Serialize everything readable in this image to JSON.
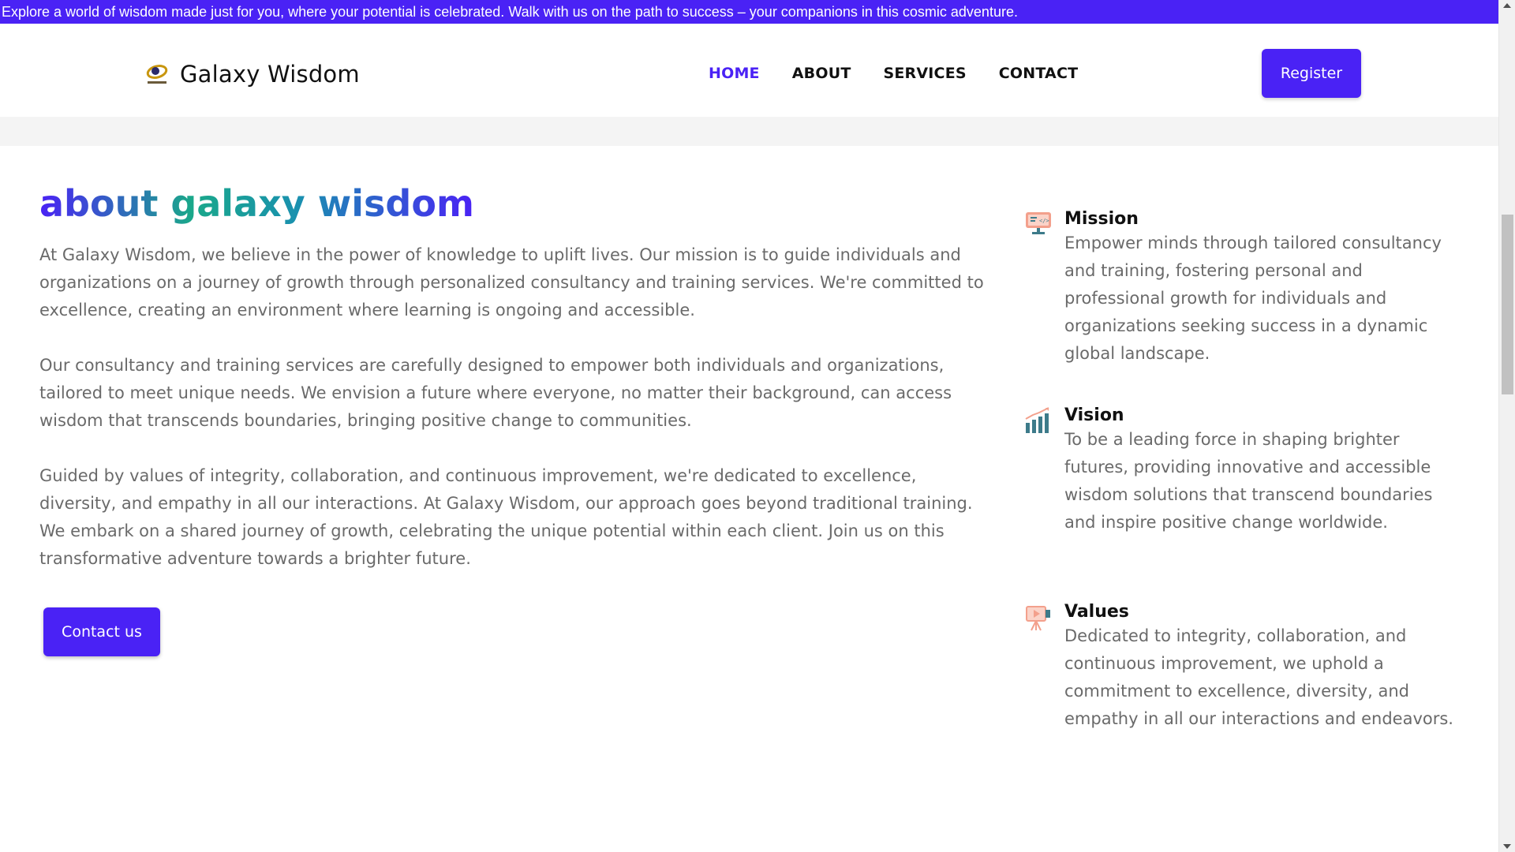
{
  "ticker": {
    "text": "Explore a world of wisdom made just for you, where your potential is celebrated. Walk with us on the path to success – your companions in this cosmic adventure."
  },
  "header": {
    "brand": "Galaxy Wisdom",
    "logo_icon": "galaxy-logo-icon",
    "nav": [
      {
        "label": "HOME",
        "active": true
      },
      {
        "label": "ABOUT",
        "active": false
      },
      {
        "label": "SERVICES",
        "active": false
      },
      {
        "label": "CONTACT",
        "active": false
      }
    ],
    "register_label": "Register"
  },
  "about": {
    "title": "about galaxy wisdom",
    "paragraphs": [
      "At Galaxy Wisdom, we believe in the power of knowledge to uplift lives. Our mission is to guide individuals and organizations on a journey of growth through personalized consultancy and training services. We're committed to excellence, creating an environment where learning is ongoing and accessible.",
      "Our consultancy and training services are carefully designed to empower both individuals and organizations, tailored to meet unique needs. We envision a future where everyone, no matter their background, can access wisdom that transcends boundaries, bringing positive change to communities.",
      "Guided by values of integrity, collaboration, and continuous improvement, we're dedicated to excellence, diversity, and empathy in all our interactions. At Galaxy Wisdom, our approach goes beyond traditional training. We embark on a shared journey of growth, celebrating the unique potential within each client. Join us on this transformative adventure towards a brighter future."
    ],
    "contact_label": "Contact us"
  },
  "features": [
    {
      "title": "Mission",
      "icon": "monitor-icon",
      "text": "Empower minds through tailored consultancy and training, fostering personal and professional growth for individuals and organizations seeking success in a dynamic global landscape."
    },
    {
      "title": "Vision",
      "icon": "bar-chart-icon",
      "text": "To be a leading force in shaping brighter futures, providing innovative and accessible wisdom solutions that transcend boundaries and inspire positive change worldwide."
    },
    {
      "title": "Values",
      "icon": "presentation-icon",
      "text": "Dedicated to integrity, collaboration, and continuous improvement, we uphold a commitment to excellence, diversity, and empathy in all our interactions and endeavors."
    }
  ],
  "colors": {
    "accent": "#4a22f5",
    "body_text": "#6a6a6a",
    "gradient_teal": "#1aa88a"
  }
}
